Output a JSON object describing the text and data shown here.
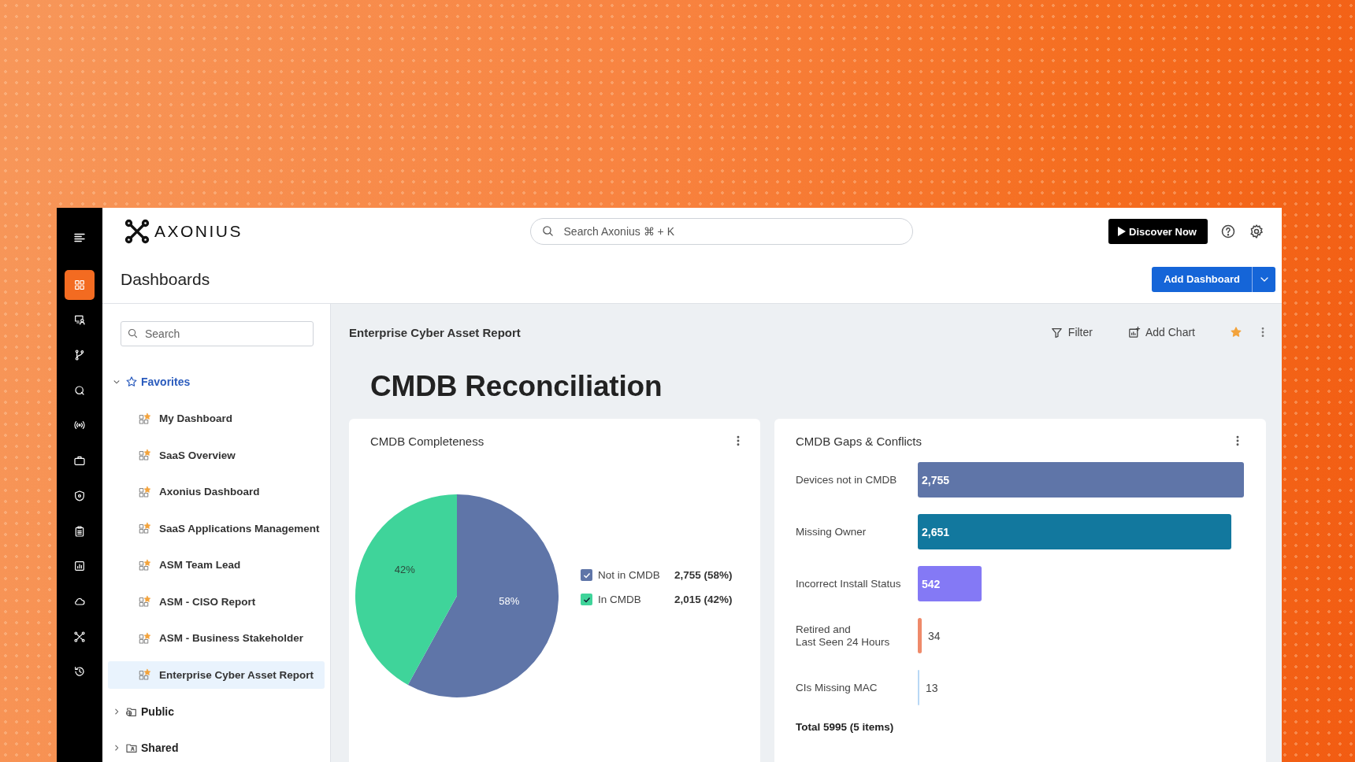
{
  "header": {
    "logo": "AXONIUS",
    "search_placeholder": "Search Axonius ⌘ + K",
    "discover_button": "Discover Now"
  },
  "page": {
    "title": "Dashboards",
    "add_button": "Add Dashboard"
  },
  "rail": [
    {
      "kind": "menu",
      "selected": false
    },
    {
      "kind": "dashboards",
      "selected": true
    },
    {
      "kind": "devices",
      "selected": false
    },
    {
      "kind": "branch",
      "selected": false
    },
    {
      "kind": "query",
      "selected": false
    },
    {
      "kind": "signal",
      "selected": false
    },
    {
      "kind": "briefcase",
      "selected": false
    },
    {
      "kind": "shield",
      "selected": false
    },
    {
      "kind": "clipboard",
      "selected": false
    },
    {
      "kind": "report",
      "selected": false
    },
    {
      "kind": "cloud",
      "selected": false
    },
    {
      "kind": "nodes",
      "selected": false
    },
    {
      "kind": "history",
      "selected": false
    }
  ],
  "sidebar": {
    "search_placeholder": "Search",
    "tree": [
      {
        "kind": "favorites",
        "label": "Favorites",
        "expanded": true,
        "children": [
          {
            "label": "My Dashboard",
            "selected": false
          },
          {
            "label": "SaaS Overview",
            "selected": false
          },
          {
            "label": "Axonius Dashboard",
            "selected": false
          },
          {
            "label": "SaaS Applications Management",
            "selected": false
          },
          {
            "label": "ASM Team Lead",
            "selected": false
          },
          {
            "label": "ASM - CISO Report",
            "selected": false
          },
          {
            "label": "ASM - Business Stakeholder",
            "selected": false
          },
          {
            "label": "Enterprise Cyber Asset Report",
            "selected": true
          }
        ]
      },
      {
        "kind": "public",
        "label": "Public",
        "expanded": false
      },
      {
        "kind": "shared",
        "label": "Shared",
        "expanded": false
      }
    ]
  },
  "dashboard": {
    "name": "Enterprise Cyber Asset Report",
    "toolbar": [
      {
        "kind": "filter",
        "label": "Filter"
      },
      {
        "kind": "add_chart",
        "label": "Add Chart"
      }
    ],
    "favorite": true,
    "heading": "CMDB Reconciliation",
    "cards": [
      {
        "title": "CMDB Completeness",
        "chart_data": {
          "type": "pie",
          "categories": [
            "Not in CMDB",
            "In CMDB"
          ],
          "values": [
            58,
            42
          ],
          "value_labels": [
            "58%",
            "42%"
          ],
          "colors": [
            "#5f75a8",
            "#3fd49a"
          ]
        },
        "legend": [
          {
            "value": "2,755 (58%)",
            "checked": true
          },
          {
            "value": "2,015 (42%)",
            "checked": true
          }
        ]
      },
      {
        "title": "CMDB Gaps & Conflicts",
        "chart_data": {
          "type": "bar",
          "orientation": "horizontal",
          "categories": [
            "Devices not in CMDB",
            "Missing Owner",
            "Incorrect Install Status",
            "Retired and\nLast Seen 24 Hours",
            "CIs Missing MAC"
          ],
          "values": [
            2755,
            2651,
            542,
            34,
            13
          ],
          "value_labels": [
            "2,755",
            "2,651",
            "542",
            "34",
            "13"
          ],
          "colors": [
            "#5f75a8",
            "#12789e",
            "#8479f5",
            "#ef8a6a",
            "#b9d8f5"
          ],
          "xlim": [
            0,
            2755
          ]
        },
        "total": "Total 5995 (5 items)"
      }
    ]
  }
}
